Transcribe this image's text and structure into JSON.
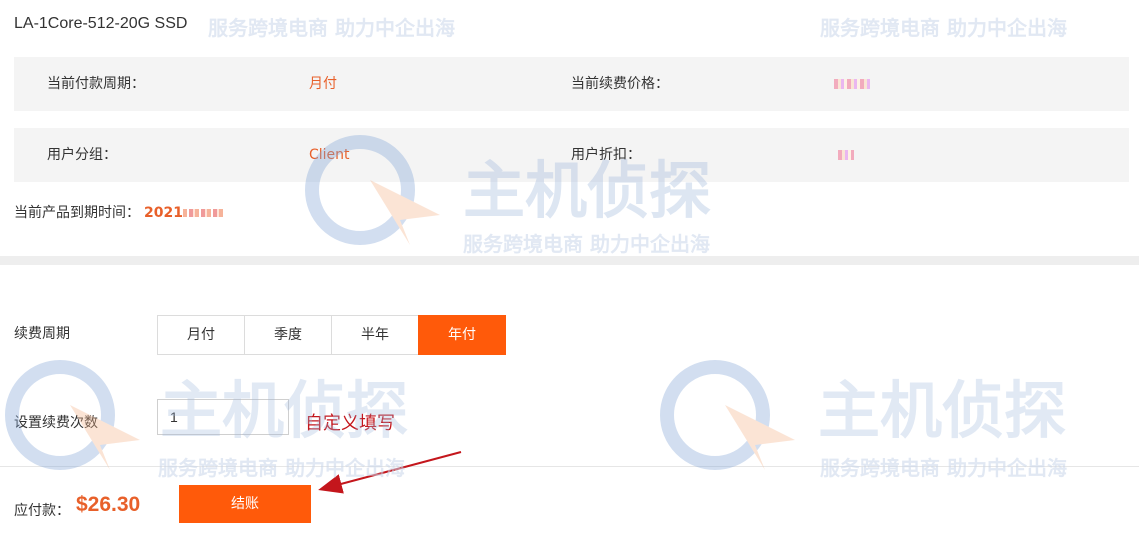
{
  "product": {
    "title": "LA-1Core-512-20G SSD"
  },
  "info": {
    "payment_cycle_label": "当前付款周期：",
    "payment_cycle_value": "月付",
    "renew_price_label": "当前续费价格：",
    "user_group_label": "用户分组：",
    "user_group_value": "Client",
    "user_discount_label": "用户折扣："
  },
  "expiry": {
    "label": "当前产品到期时间：",
    "date_prefix": "2021"
  },
  "renew": {
    "period_label": "续费周期",
    "periods": [
      "月付",
      "季度",
      "半年",
      "年付"
    ],
    "selected_period": "年付",
    "times_label": "设置续费次数",
    "times_value": "1",
    "annotation": "自定义填写"
  },
  "checkout": {
    "due_label": "应付款：",
    "due_amount": "$26.30",
    "button_label": "结账"
  },
  "watermark": {
    "text": "服务跨境电商 助力中企出海",
    "brand": "主机侦探"
  },
  "colors": {
    "accent": "#ff5a0a",
    "value_orange": "#e8602a",
    "annotation_red": "#c4161c"
  }
}
